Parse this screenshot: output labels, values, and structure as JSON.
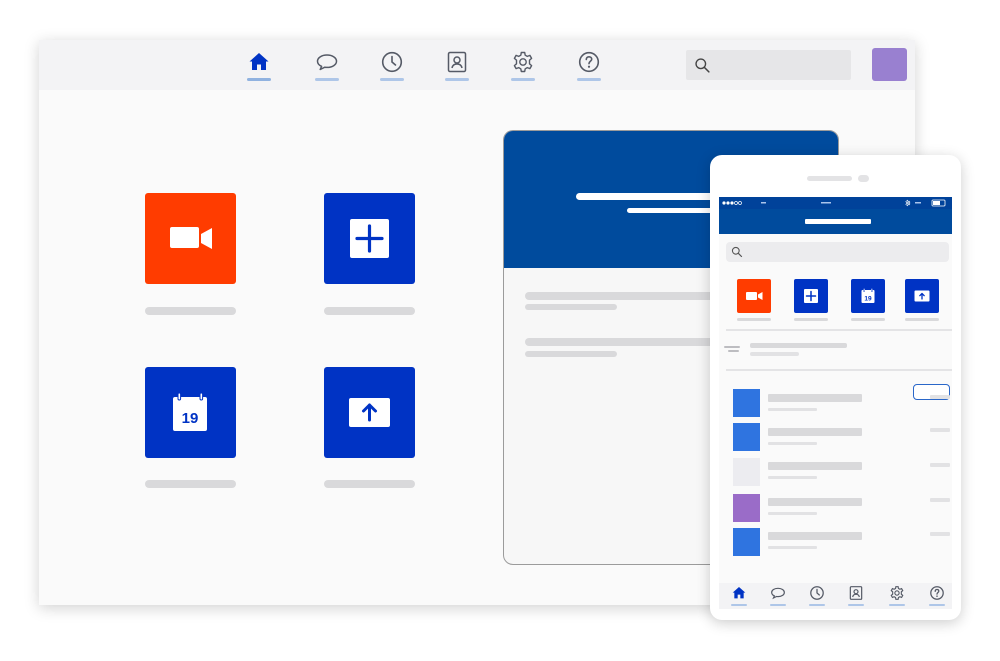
{
  "colors": {
    "brand_blue": "#0033c4",
    "header_blue": "#004b9d",
    "meet_orange": "#ff3c00",
    "avatar_purple": "#9980d0",
    "nav_active": "#0033c4",
    "nav_inactive": "#555a66"
  },
  "nav": {
    "items": [
      {
        "icon": "home-icon",
        "active": true
      },
      {
        "icon": "chat-icon",
        "active": false
      },
      {
        "icon": "clock-icon",
        "active": false
      },
      {
        "icon": "contacts-icon",
        "active": false
      },
      {
        "icon": "gear-icon",
        "active": false
      },
      {
        "icon": "help-icon",
        "active": false
      }
    ]
  },
  "search": {
    "icon": "search-icon"
  },
  "tiles": [
    {
      "name": "video-meeting-tile",
      "icon": "video-camera-icon"
    },
    {
      "name": "new-meeting-tile",
      "icon": "plus-icon"
    },
    {
      "name": "schedule-tile",
      "icon": "calendar-icon"
    },
    {
      "name": "share-screen-tile",
      "icon": "upload-icon"
    }
  ],
  "calendar": {
    "day": "19"
  },
  "mobile": {
    "calendar_day": "19"
  }
}
